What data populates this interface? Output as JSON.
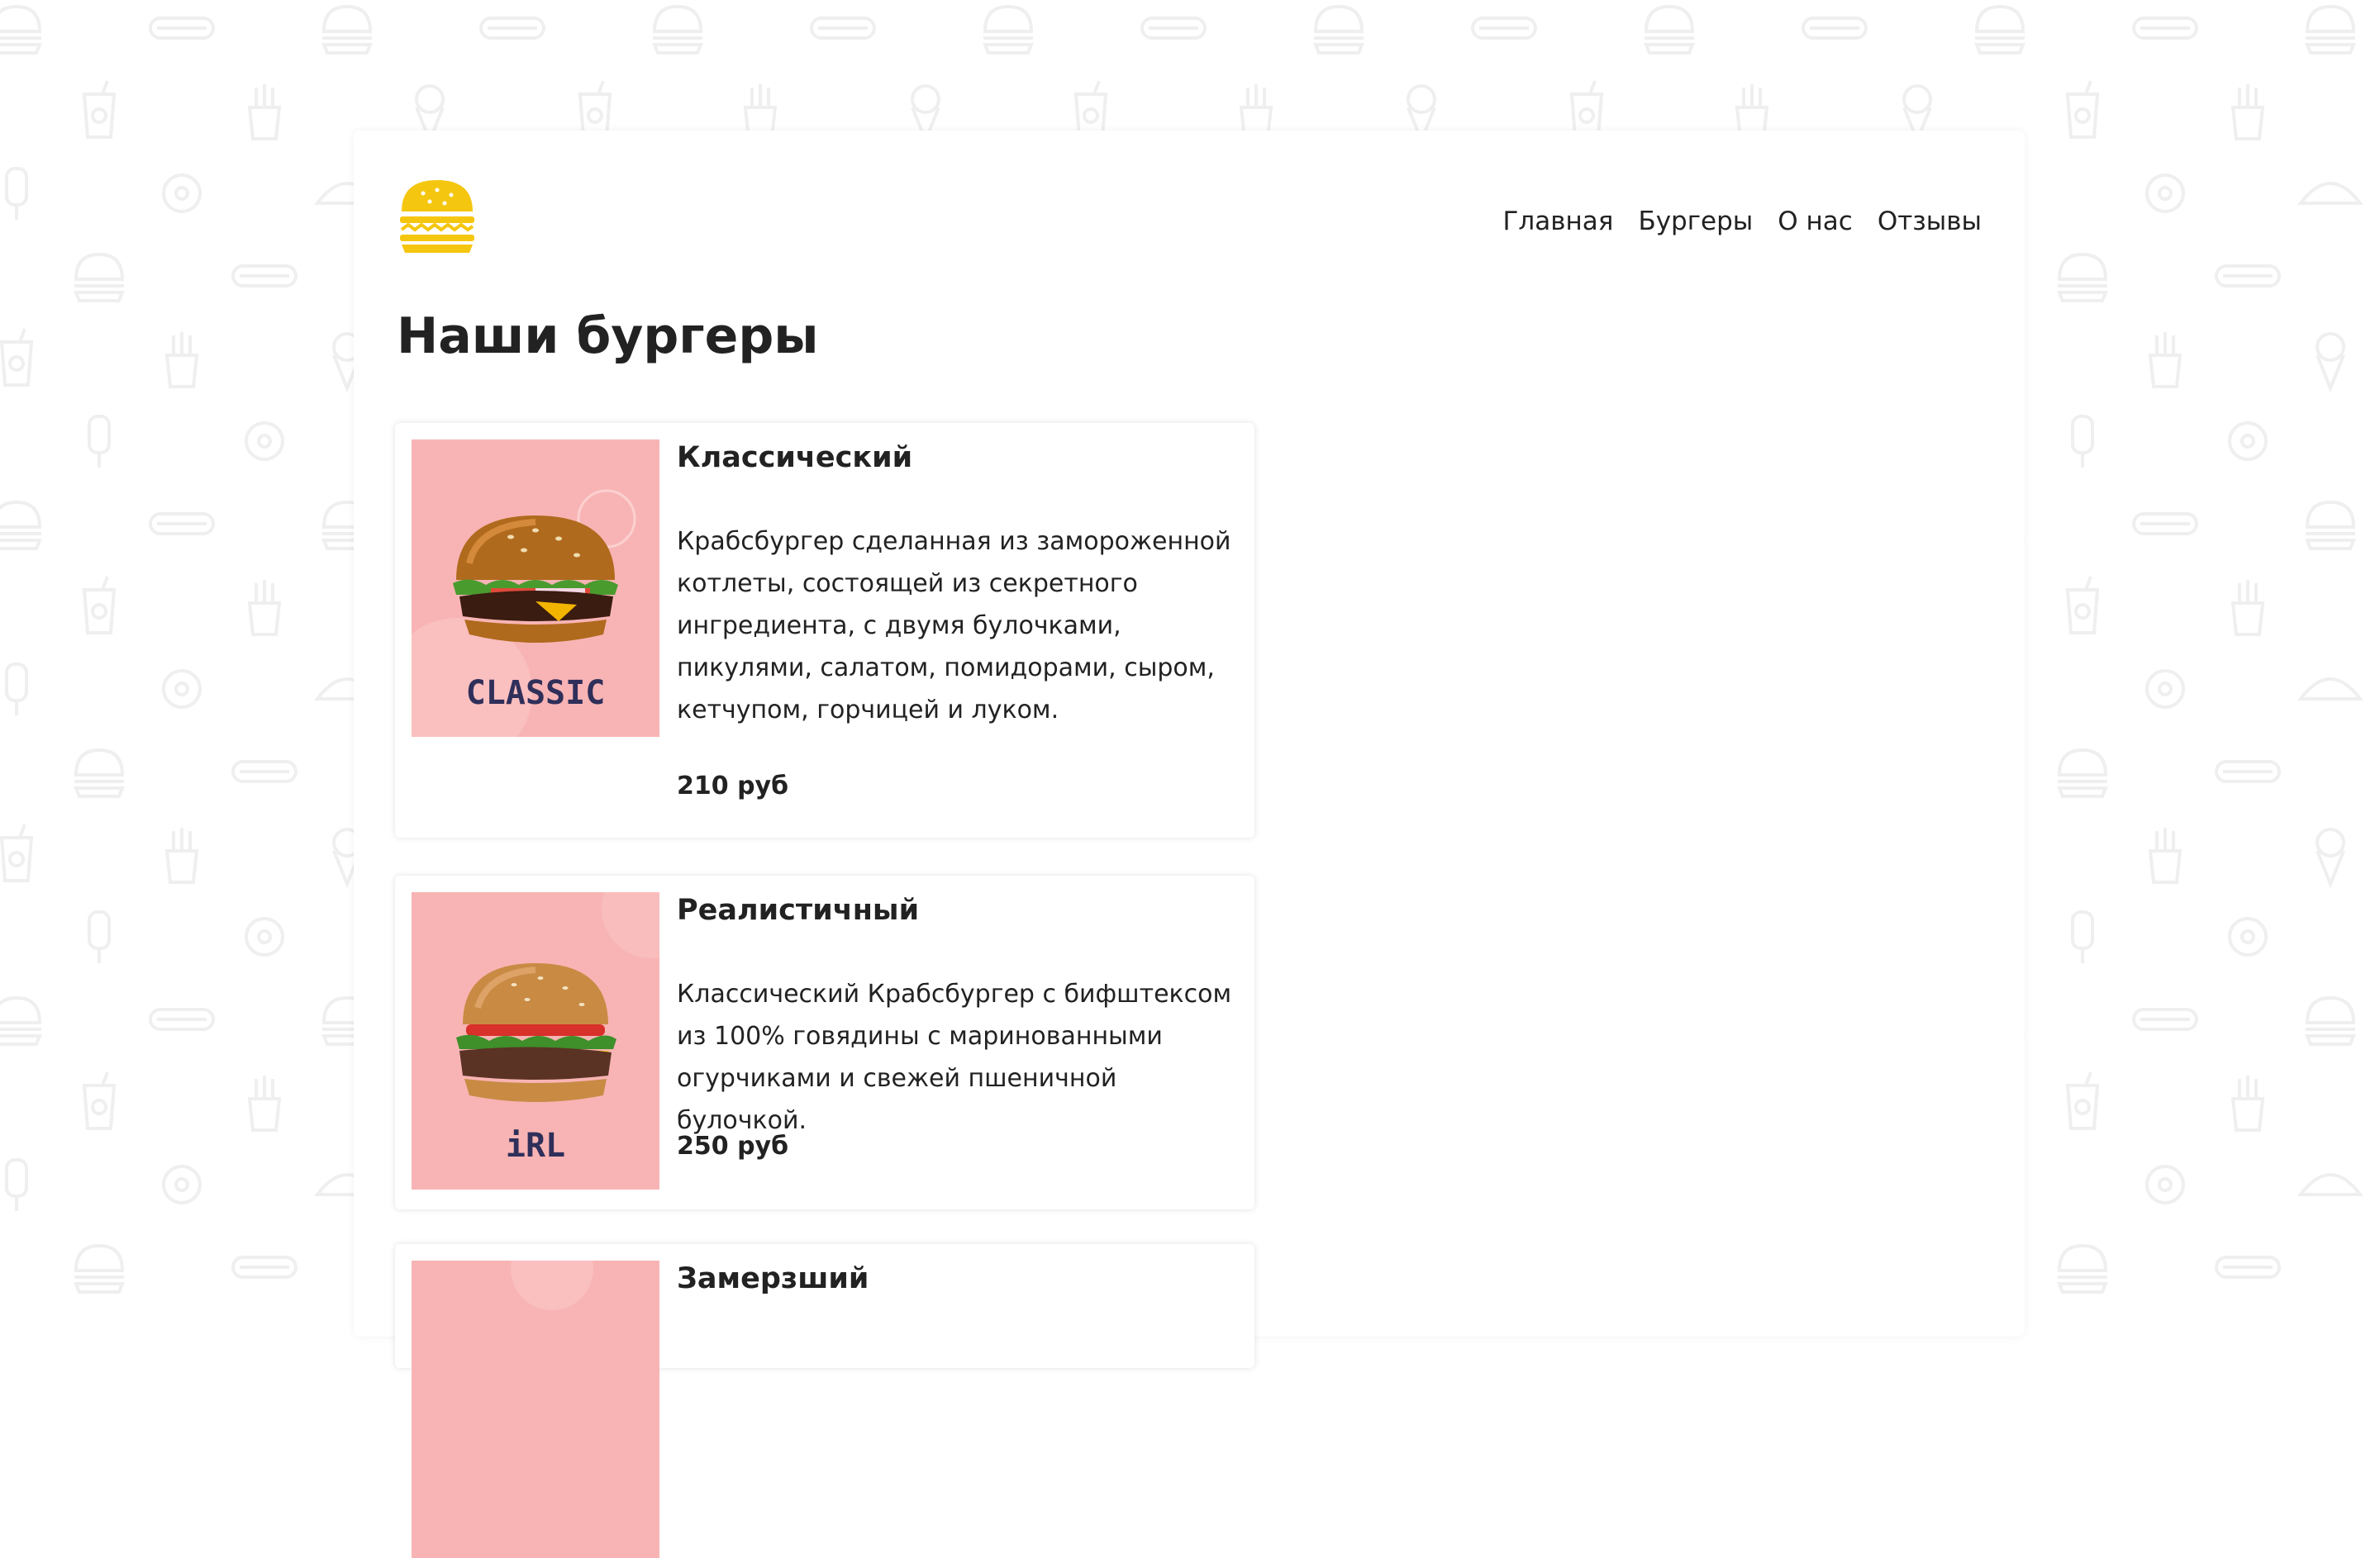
{
  "colors": {
    "brand_yellow": "#f5c60f",
    "card_image_bg": "#f8b4b4",
    "text": "#222222",
    "pattern": "#f2f2f2"
  },
  "logo": {
    "icon": "burger-icon"
  },
  "nav": {
    "items": [
      {
        "label": "Главная"
      },
      {
        "label": "Бургеры"
      },
      {
        "label": "О нас"
      },
      {
        "label": "Отзывы"
      }
    ]
  },
  "main": {
    "title": "Наши бургеры"
  },
  "burgers": [
    {
      "name": "Классический",
      "image_label": "CLASSIC",
      "description": "Крабсбургер сделанная из замороженной котлеты, состоящей из секретного ингредиента, с двумя булочками, пикулями, салатом, помидорами, сыром, кетчупом, горчицей и луком.",
      "price": "210 руб"
    },
    {
      "name": "Реалистичный",
      "image_label": "iRL",
      "description": "Классический Крабсбургер с бифштексом из 100% говядины с маринованными огурчиками и свежей пшеничной булочкой.",
      "price": "250 руб"
    },
    {
      "name": "Замерзший"
    }
  ]
}
